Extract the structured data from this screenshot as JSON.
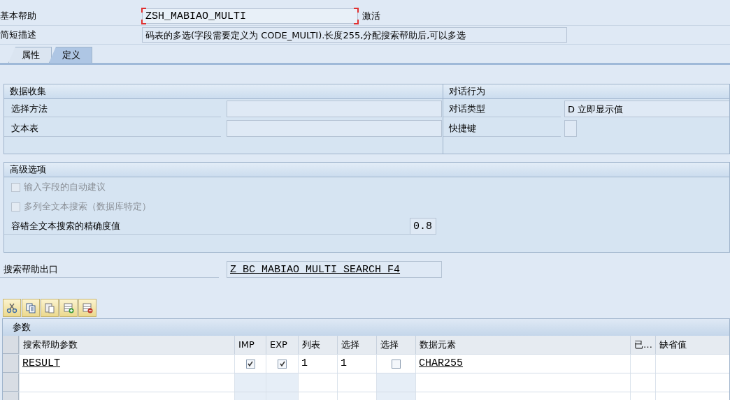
{
  "header": {
    "fields": [
      {
        "label": "基本帮助",
        "value": "ZSH_MABIAO_MULTI",
        "focused": true,
        "status": "激活"
      },
      {
        "label": "简短描述",
        "value": "码表的多选(字段需要定义为 CODE_MULTI).长度255,分配搜索帮助后,可以多选",
        "focused": false
      }
    ]
  },
  "tabs": [
    {
      "label": "属性",
      "selected": false
    },
    {
      "label": "定义",
      "selected": true
    }
  ],
  "data_collection": {
    "title": "数据收集",
    "fields": [
      {
        "label": "选择方法"
      },
      {
        "label": "文本表"
      }
    ]
  },
  "dialog": {
    "title": "对话行为",
    "type_label": "对话类型",
    "type_value": "D 立即显示值",
    "hotkey_label": "快捷键"
  },
  "advanced": {
    "title": "高级选项",
    "options": [
      {
        "label": "输入字段的自动建议",
        "checked": false,
        "disabled": true
      },
      {
        "label": "多列全文本搜索（数据库特定）",
        "checked": false,
        "disabled": true
      }
    ],
    "accuracy_label": "容错全文本搜索的精确度值",
    "accuracy_value": "0.8"
  },
  "exit": {
    "label": "搜索帮助出口",
    "value": "Z_BC_MABIAO_MULTI_SEARCH_F4"
  },
  "params": {
    "title": "参数",
    "columns": [
      "搜索帮助参数",
      "IMP",
      "EXP",
      "列表",
      "选择",
      "选择",
      "数据元素",
      "已…",
      "缺省值"
    ],
    "rows": [
      {
        "param": "RESULT",
        "imp": true,
        "exp": true,
        "list": "1",
        "select": "1",
        "select_flag": false,
        "data_element": "CHAR255"
      }
    ]
  }
}
